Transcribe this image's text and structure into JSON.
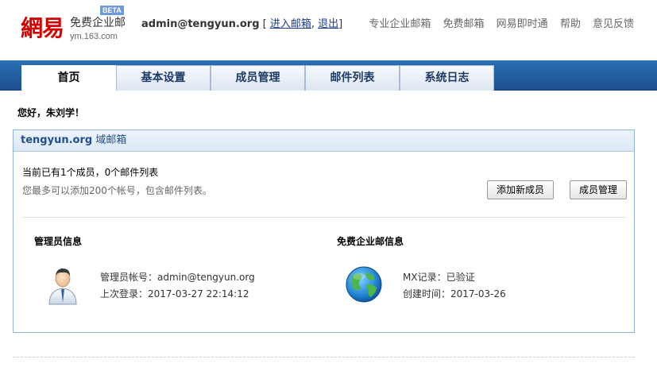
{
  "logo": {
    "mark": "網易",
    "product": "免费企业邮",
    "beta": "BETA",
    "domain": "ym.163.com"
  },
  "account": {
    "email": "admin@tengyun.org",
    "bracket_open": "[",
    "enter_mailbox": "进入邮箱",
    "separator": ",",
    "logout": "退出",
    "bracket_close": "]"
  },
  "toplinks": [
    "专业企业邮箱",
    "免费邮箱",
    "网易即时通",
    "帮助",
    "意见反馈"
  ],
  "nav": {
    "tabs": [
      {
        "label": "首页",
        "active": true
      },
      {
        "label": "基本设置",
        "active": false
      },
      {
        "label": "成员管理",
        "active": false
      },
      {
        "label": "邮件列表",
        "active": false
      },
      {
        "label": "系统日志",
        "active": false
      }
    ]
  },
  "greeting": "您好，朱刘学！",
  "panel": {
    "domain": "tengyun.org",
    "title_suffix": "域邮箱",
    "stats_line": "当前已有1个成员，0个邮件列表",
    "limit_line": "您最多可以添加200个帐号，包含邮件列表。",
    "add_member_label": "添加新成员",
    "manage_members_label": "成员管理"
  },
  "admin_info": {
    "title": "管理员信息",
    "account_label": "管理员帐号：",
    "account_value": "admin@tengyun.org",
    "last_login_label": "上次登录：",
    "last_login_value": "2017-03-27 22:14:12"
  },
  "free_mail_info": {
    "title": "免费企业邮信息",
    "mx_label": "MX记录：",
    "mx_value": "已验证",
    "created_label": "创建时间：",
    "created_value": "2017-03-26"
  },
  "colors": {
    "brand_red": "#d40000",
    "nav_blue": "#1f5a9e",
    "panel_border": "#8fb3d9",
    "link": "#1a3f8c"
  },
  "icons": {
    "avatar": "admin-avatar-icon",
    "globe": "globe-icon"
  }
}
